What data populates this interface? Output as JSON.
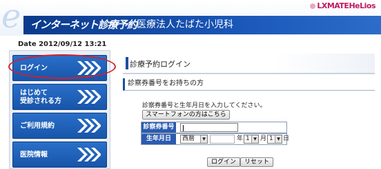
{
  "header": {
    "logo_letter": "e",
    "service_title": "インターネット診療予約",
    "clinic_name": "医療法人たばた小児科",
    "brand": "LXMATEHeLios"
  },
  "sidebar": {
    "date": "Date 2012/09/12 13:21",
    "items": [
      {
        "label_line1": "ログイン",
        "label_line2": ""
      },
      {
        "label_line1": "はじめて",
        "label_line2": "受診される方"
      },
      {
        "label_line1": "ご利用規約",
        "label_line2": ""
      },
      {
        "label_line1": "医院情報",
        "label_line2": ""
      }
    ]
  },
  "main": {
    "page_title": "診療予約ログイン",
    "section_title": "診察券番号をお持ちの方",
    "instruction": "診察券番号と生年月日を入力してください。",
    "smartphone_button": "スマートフォンの方はこちら",
    "form": {
      "card_label": "診察券番号",
      "card_value": "",
      "dob_label": "生年月日",
      "era_value": "西暦",
      "year_value": "",
      "year_unit": "年",
      "month_value": "1",
      "month_unit": "月",
      "day_value": "1",
      "day_unit": "日"
    },
    "login_button": "ログイン",
    "reset_button": "リセット"
  },
  "colors": {
    "header_blue": "#1a57b8",
    "menu_blue": "#1855aa",
    "label_blue": "#2b5bb0",
    "highlight_red": "#d2202a",
    "brand_pink": "#c2185b"
  }
}
